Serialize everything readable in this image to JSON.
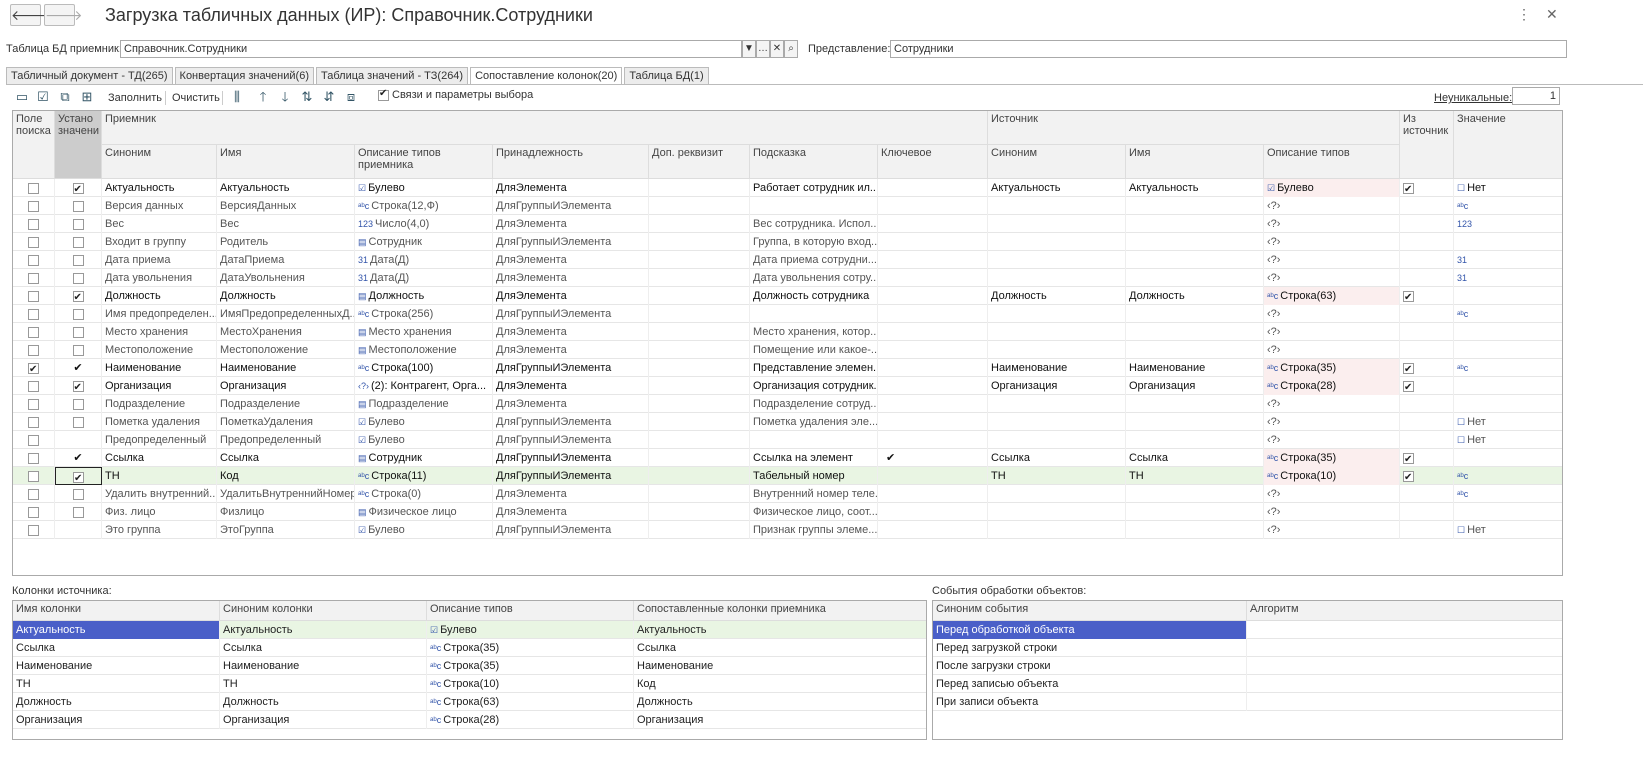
{
  "window": {
    "title": "Загрузка табличных данных (ИР): Справочник.Сотрудники",
    "back_icon": "back-arrow-icon",
    "forward_icon": "forward-arrow-icon",
    "more_icon": "more-vertical-icon",
    "close_icon": "close-icon"
  },
  "form": {
    "target_label": "Таблица БД приемник:",
    "target_value": "Справочник.Сотрудники",
    "repr_label": "Представление:",
    "repr_value": "Сотрудники"
  },
  "tabs": [
    "Табличный документ - ТД(265)",
    "Конвертация значений(6)",
    "Таблица значений - ТЗ(264)",
    "Сопоставление колонок(20)",
    "Таблица БД(1)"
  ],
  "toolbar": {
    "fill": "Заполнить",
    "clear": "Очистить",
    "links_label": "Связи и параметры выбора",
    "nonunique_label": "Неуникальные:",
    "nonunique_value": "1"
  },
  "main_headers": {
    "search": "Поле поиска",
    "set": "Устано значени",
    "receiver": "Приемник",
    "source": "Источник",
    "from_source": "Из источник",
    "value": "Значение",
    "synonym": "Синоним",
    "name": "Имя",
    "types": "Описание типов приемника",
    "owner": "Принадлежность",
    "extra": "Доп. реквизит",
    "hint": "Подсказка",
    "key": "Ключевое",
    "src_synonym": "Синоним",
    "src_name": "Имя",
    "src_types": "Описание типов"
  },
  "rows": [
    {
      "search": false,
      "set": true,
      "syn": "Актуальность",
      "name": "Актуальность",
      "ti": "☑",
      "types": "Булево",
      "owner": "ДляЭлемента",
      "hint": "Работает сотрудник ил...",
      "key": "",
      "ssyn": "Актуальность",
      "sname": "Актуальность",
      "sti": "☑",
      "stypes": "Булево",
      "from": true,
      "vi": "☐",
      "val": "Нет",
      "bold": true
    },
    {
      "search": false,
      "set": false,
      "syn": "Версия данных",
      "name": "ВерсияДанных",
      "ti": "ᵃᵇc",
      "types": "Строка(12,Ф)",
      "owner": "ДляГруппыИЭлемента",
      "hint": "",
      "key": "",
      "ssyn": "",
      "sname": "",
      "sti": "",
      "stypes": "‹?›",
      "from": null,
      "vi": "ᵃᵇc",
      "val": "",
      "bold": false
    },
    {
      "search": false,
      "set": false,
      "syn": "Вес",
      "name": "Вес",
      "ti": "123",
      "types": "Число(4,0)",
      "owner": "ДляЭлемента",
      "hint": "Вес сотрудника. Испол...",
      "key": "",
      "ssyn": "",
      "sname": "",
      "sti": "",
      "stypes": "‹?›",
      "from": null,
      "vi": "123",
      "val": "",
      "bold": false
    },
    {
      "search": false,
      "set": false,
      "syn": "Входит в группу",
      "name": "Родитель",
      "ti": "▤",
      "types": "Сотрудник",
      "owner": "ДляГруппыИЭлемента",
      "hint": "Группа, в которую вход...",
      "key": "",
      "ssyn": "",
      "sname": "",
      "sti": "",
      "stypes": "‹?›",
      "from": null,
      "vi": "",
      "val": "",
      "bold": false
    },
    {
      "search": false,
      "set": false,
      "syn": "Дата приема",
      "name": "ДатаПриема",
      "ti": "31",
      "types": "Дата(Д)",
      "owner": "ДляЭлемента",
      "hint": "Дата приема сотрудни...",
      "key": "",
      "ssyn": "",
      "sname": "",
      "sti": "",
      "stypes": "‹?›",
      "from": null,
      "vi": "31",
      "val": "",
      "bold": false
    },
    {
      "search": false,
      "set": false,
      "syn": "Дата увольнения",
      "name": "ДатаУвольнения",
      "ti": "31",
      "types": "Дата(Д)",
      "owner": "ДляЭлемента",
      "hint": "Дата увольнения сотру...",
      "key": "",
      "ssyn": "",
      "sname": "",
      "sti": "",
      "stypes": "‹?›",
      "from": null,
      "vi": "31",
      "val": "",
      "bold": false
    },
    {
      "search": false,
      "set": true,
      "syn": "Должность",
      "name": "Должность",
      "ti": "▤",
      "types": "Должность",
      "owner": "ДляЭлемента",
      "hint": "Должность сотрудника",
      "key": "",
      "ssyn": "Должность",
      "sname": "Должность",
      "sti": "ᵃᵇc",
      "stypes": "Строка(63)",
      "from": true,
      "vi": "",
      "val": "",
      "bold": true
    },
    {
      "search": false,
      "set": false,
      "syn": "Имя предопределен...",
      "name": "ИмяПредопределенныхД...",
      "ti": "ᵃᵇc",
      "types": "Строка(256)",
      "owner": "ДляГруппыИЭлемента",
      "hint": "",
      "key": "",
      "ssyn": "",
      "sname": "",
      "sti": "",
      "stypes": "‹?›",
      "from": null,
      "vi": "ᵃᵇc",
      "val": "",
      "bold": false
    },
    {
      "search": false,
      "set": false,
      "syn": "Место хранения",
      "name": "МестоХранения",
      "ti": "▤",
      "types": "Место хранения",
      "owner": "ДляЭлемента",
      "hint": "Место хранения, котор...",
      "key": "",
      "ssyn": "",
      "sname": "",
      "sti": "",
      "stypes": "‹?›",
      "from": null,
      "vi": "",
      "val": "",
      "bold": false
    },
    {
      "search": false,
      "set": false,
      "syn": "Местоположение",
      "name": "Местоположение",
      "ti": "▤",
      "types": "Местоположение",
      "owner": "ДляЭлемента",
      "hint": "Помещение или какое-...",
      "key": "",
      "ssyn": "",
      "sname": "",
      "sti": "",
      "stypes": "‹?›",
      "from": null,
      "vi": "",
      "val": "",
      "bold": false
    },
    {
      "search": true,
      "set": true,
      "setplain": true,
      "syn": "Наименование",
      "name": "Наименование",
      "ti": "ᵃᵇc",
      "types": "Строка(100)",
      "owner": "ДляГруппыИЭлемента",
      "hint": "Представление элемен...",
      "key": "",
      "ssyn": "Наименование",
      "sname": "Наименование",
      "sti": "ᵃᵇc",
      "stypes": "Строка(35)",
      "from": true,
      "vi": "ᵃᵇc",
      "val": "",
      "bold": true
    },
    {
      "search": false,
      "set": true,
      "syn": "Организация",
      "name": "Организация",
      "ti": "‹?›",
      "types": "(2): Контрагент, Орга...",
      "owner": "ДляЭлемента",
      "hint": "Организация сотрудник...",
      "key": "",
      "ssyn": "Организация",
      "sname": "Организация",
      "sti": "ᵃᵇc",
      "stypes": "Строка(28)",
      "from": true,
      "vi": "",
      "val": "",
      "bold": true
    },
    {
      "search": false,
      "set": false,
      "syn": "Подразделение",
      "name": "Подразделение",
      "ti": "▤",
      "types": "Подразделение",
      "owner": "ДляЭлемента",
      "hint": "Подразделение сотруд...",
      "key": "",
      "ssyn": "",
      "sname": "",
      "sti": "",
      "stypes": "‹?›",
      "from": null,
      "vi": "",
      "val": "",
      "bold": false
    },
    {
      "search": false,
      "set": false,
      "syn": "Пометка удаления",
      "name": "ПометкаУдаления",
      "ti": "☑",
      "types": "Булево",
      "owner": "ДляГруппыИЭлемента",
      "hint": "Пометка удаления эле...",
      "key": "",
      "ssyn": "",
      "sname": "",
      "sti": "",
      "stypes": "‹?›",
      "from": null,
      "vi": "☐",
      "val": "Нет",
      "bold": false
    },
    {
      "search": false,
      "set": false,
      "noset": true,
      "syn": "Предопределенный",
      "name": "Предопределенный",
      "ti": "☑",
      "types": "Булево",
      "owner": "ДляГруппыИЭлемента",
      "hint": "",
      "key": "",
      "ssyn": "",
      "sname": "",
      "sti": "",
      "stypes": "‹?›",
      "from": null,
      "vi": "☐",
      "val": "Нет",
      "bold": false
    },
    {
      "search": false,
      "set": true,
      "setplain": true,
      "syn": "Ссылка",
      "name": "Ссылка",
      "ti": "▤",
      "types": "Сотрудник",
      "owner": "ДляГруппыИЭлемента",
      "hint": "Ссылка на элемент",
      "key": "✔",
      "ssyn": "Ссылка",
      "sname": "Ссылка",
      "sti": "ᵃᵇc",
      "stypes": "Строка(35)",
      "from": true,
      "vi": "",
      "val": "",
      "bold": true
    },
    {
      "search": false,
      "set": true,
      "syn": "ТН",
      "name": "Код",
      "ti": "ᵃᵇc",
      "types": "Строка(11)",
      "owner": "ДляГруппыИЭлемента",
      "hint": "Табельный номер",
      "key": "",
      "ssyn": "ТН",
      "sname": "ТН",
      "sti": "ᵃᵇc",
      "stypes": "Строка(10)",
      "from": true,
      "vi": "ᵃᵇc",
      "val": "",
      "bold": true,
      "selected": true
    },
    {
      "search": false,
      "set": false,
      "syn": "Удалить внутренний...",
      "name": "УдалитьВнутреннийНомер",
      "ti": "ᵃᵇc",
      "types": "Строка(0)",
      "owner": "ДляЭлемента",
      "hint": "Внутренний номер теле...",
      "key": "",
      "ssyn": "",
      "sname": "",
      "sti": "",
      "stypes": "‹?›",
      "from": null,
      "vi": "ᵃᵇc",
      "val": "",
      "bold": false
    },
    {
      "search": false,
      "set": false,
      "syn": "Физ. лицо",
      "name": "Физлицо",
      "ti": "▤",
      "types": "Физическое лицо",
      "owner": "ДляЭлемента",
      "hint": "Физическое лицо, соот...",
      "key": "",
      "ssyn": "",
      "sname": "",
      "sti": "",
      "stypes": "‹?›",
      "from": null,
      "vi": "",
      "val": "",
      "bold": false
    },
    {
      "search": false,
      "set": false,
      "noset": true,
      "syn": "Это группа",
      "name": "ЭтоГруппа",
      "ti": "☑",
      "types": "Булево",
      "owner": "ДляГруппыИЭлемента",
      "hint": "Признак группы элеме...",
      "key": "",
      "ssyn": "",
      "sname": "",
      "sti": "",
      "stypes": "‹?›",
      "from": null,
      "vi": "☐",
      "val": "Нет",
      "bold": false
    }
  ],
  "source_cols": {
    "label": "Колонки источника:",
    "headers": [
      "Имя колонки",
      "Синоним колонки",
      "Описание типов",
      "Сопоставленные колонки приемника"
    ],
    "rows": [
      [
        "Актуальность",
        "Актуальность",
        "☑",
        "Булево",
        "Актуальность"
      ],
      [
        "Ссылка",
        "Ссылка",
        "ᵃᵇc",
        "Строка(35)",
        "Ссылка"
      ],
      [
        "Наименование",
        "Наименование",
        "ᵃᵇc",
        "Строка(35)",
        "Наименование"
      ],
      [
        "ТН",
        "ТН",
        "ᵃᵇc",
        "Строка(10)",
        "Код"
      ],
      [
        "Должность",
        "Должность",
        "ᵃᵇc",
        "Строка(63)",
        "Должность"
      ],
      [
        "Организация",
        "Организация",
        "ᵃᵇc",
        "Строка(28)",
        "Организация"
      ]
    ]
  },
  "events": {
    "label": "События обработки объектов:",
    "headers": [
      "Синоним события",
      "Алгоритм"
    ],
    "rows": [
      "Перед обработкой объекта",
      "Перед загрузкой строки",
      "После загрузки строки",
      "Перед записью объекта",
      "При записи объекта"
    ]
  }
}
